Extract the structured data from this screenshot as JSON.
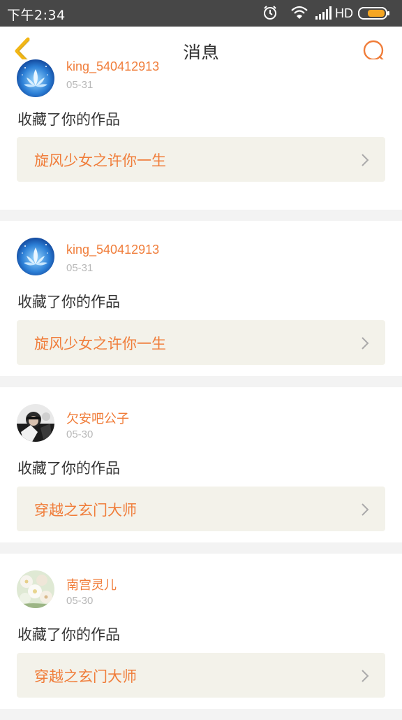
{
  "status_bar": {
    "time": "下午2:34",
    "network_label": "HD",
    "icons": [
      "alarm-icon",
      "wifi-icon",
      "signal-icon",
      "battery-icon"
    ]
  },
  "header": {
    "title": "消息",
    "back_icon": "chevron-left-icon",
    "search_icon": "search-icon"
  },
  "colors": {
    "accent": "#f07d3a",
    "back_icon": "#f2b616",
    "card_bg": "#f3f2ea",
    "separator": "#f3f3f3",
    "status_bar": "#474747"
  },
  "messages": [
    {
      "username": "king_540412913",
      "date": "05-31",
      "action": "收藏了你的作品",
      "work_title": "旋风少女之许你一生",
      "avatar": "lotus-avatar"
    },
    {
      "username": "king_540412913",
      "date": "05-31",
      "action": "收藏了你的作品",
      "work_title": "旋风少女之许你一生",
      "avatar": "lotus-avatar"
    },
    {
      "username": "欠安吧公子",
      "date": "05-30",
      "action": "收藏了你的作品",
      "work_title": "穿越之玄门大师",
      "avatar": "photo-avatar"
    },
    {
      "username": "南宫灵儿",
      "date": "05-30",
      "action": "收藏了你的作品",
      "work_title": "穿越之玄门大师",
      "avatar": "flower-avatar"
    }
  ]
}
